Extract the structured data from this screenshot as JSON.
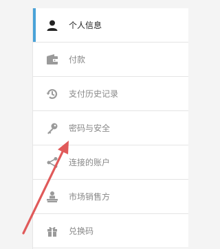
{
  "menu": {
    "items": [
      {
        "label": "个人信息",
        "icon": "person-icon",
        "active": true
      },
      {
        "label": "付款",
        "icon": "wallet-icon",
        "active": false
      },
      {
        "label": "支付历史记录",
        "icon": "history-icon",
        "active": false
      },
      {
        "label": "密码与安全",
        "icon": "key-icon",
        "active": false
      },
      {
        "label": "连接的账户",
        "icon": "share-icon",
        "active": false
      },
      {
        "label": "市场销售方",
        "icon": "seller-icon",
        "active": false
      },
      {
        "label": "兑换码",
        "icon": "gift-icon",
        "active": false
      }
    ]
  },
  "colors": {
    "accent": "#4aa3d8",
    "arrow": "#e05a5a",
    "icon_inactive": "#9a9a9a",
    "icon_active": "#222222"
  }
}
